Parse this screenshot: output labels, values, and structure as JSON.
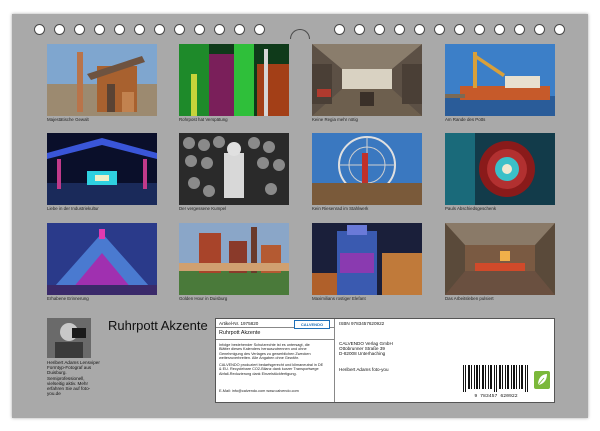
{
  "calendar": {
    "title": "Ruhrpott Akzente",
    "photos": [
      {
        "caption": "Majestätische Gewalt"
      },
      {
        "caption": "Rohrpost hat Verspätung"
      },
      {
        "caption": "Keine Regia mehr nötig"
      },
      {
        "caption": "Am Rande des Potts"
      },
      {
        "caption": "Liebe in der Industriekultur"
      },
      {
        "caption": "Der vergessene Kumpel"
      },
      {
        "caption": "Kein Riesenrad im Stahlwerk"
      },
      {
        "caption": "Pauls Abschiedsgeschenk"
      },
      {
        "caption": "Erhabene Erinnerung"
      },
      {
        "caption": "Golden Hour in Duisburg"
      },
      {
        "caption": "Maximilians rostiger Elefant"
      },
      {
        "caption": "Das Arbeitsleben pulsiert"
      }
    ]
  },
  "author": {
    "name": "Heribert Adams Lensviper",
    "bio_lines": [
      "Formtyp-Fotograf aus",
      "Duisburg.",
      "Semiprofessionell,",
      "vielseitig aktiv. Mehr",
      "erfahren Sie auf foto-",
      "you.de"
    ]
  },
  "info": {
    "article_no": "Artikel-Nr. 1975820",
    "publisher_logo": "CALVENDO",
    "title": "Ruhrpott Akzente",
    "desc_lines": [
      "Infolge bestehender Schutzrechte ist es untersagt, die",
      "Blätter dieses Kalenders herauszutrennen und ohne",
      "Genehmigung des Verlages zu gewerblichen Zwecken",
      "weiterzuverbreiten. Alle Angaben ohne Gewähr."
    ],
    "env_lines": [
      "CALVENDO produziert bedarfsgerecht und klimaneutral in DE",
      "& EU. Recyclebare CO2-Bilanz dank kurzer Transportwege",
      "Abfall-Reduzierung dank Einzelstückfertigung."
    ],
    "contact": "E-Mail: info@calvendo.com  www.calvendo.com",
    "isbn": "ISBN 9783457620922",
    "publisher_lines": [
      "CALVENDO Verlag GmbH",
      "Ottobrunner Straße 39",
      "D-82008 Unterhaching"
    ],
    "credit": "Heribert Adams foto-you",
    "barcode_number": "9 783457 620922"
  }
}
